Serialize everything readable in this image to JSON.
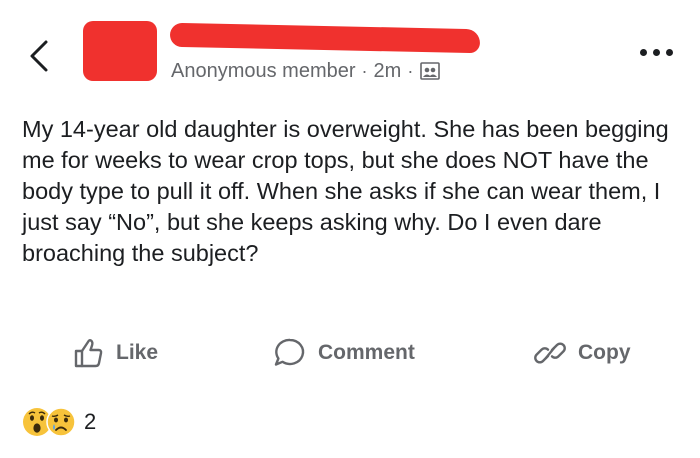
{
  "header": {
    "author_role": "Anonymous member",
    "separator": "·",
    "timestamp": "2m",
    "audience_icon": "group-icon"
  },
  "post": {
    "text": "My 14-year old daughter is overweight. She has been begging me for weeks to wear crop tops, but she does NOT have the body type to pull it off. When she asks if she can wear them, I just say “No”, but she keeps asking why. Do I even dare broaching the subject?"
  },
  "actions": {
    "like_label": "Like",
    "comment_label": "Comment",
    "copy_label": "Copy"
  },
  "reactions": {
    "icons": [
      "wow-emoji",
      "sad-emoji"
    ],
    "count": "2"
  },
  "colors": {
    "redaction": "#f0312e",
    "secondary_text": "#65676b",
    "primary_text": "#1c1e21",
    "emoji_yellow": "#f7c33b"
  }
}
